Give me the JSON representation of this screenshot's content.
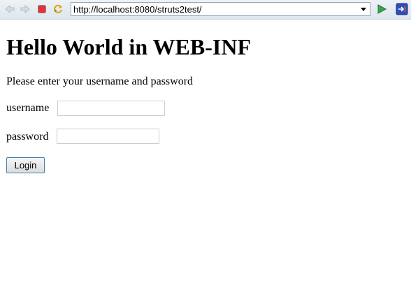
{
  "browser": {
    "url": "http://localhost:8080/struts2test/",
    "icons": {
      "back": "back-arrow-icon",
      "forward": "forward-arrow-icon",
      "stop": "stop-icon",
      "refresh": "refresh-icon",
      "go": "go-play-icon",
      "external": "external-browser-icon"
    }
  },
  "page": {
    "title": "Hello World in WEB-INF",
    "intro": "Please enter your username and password",
    "form": {
      "username_label": "username",
      "username_value": "",
      "password_label": "password",
      "password_value": "",
      "submit_label": "Login"
    }
  }
}
